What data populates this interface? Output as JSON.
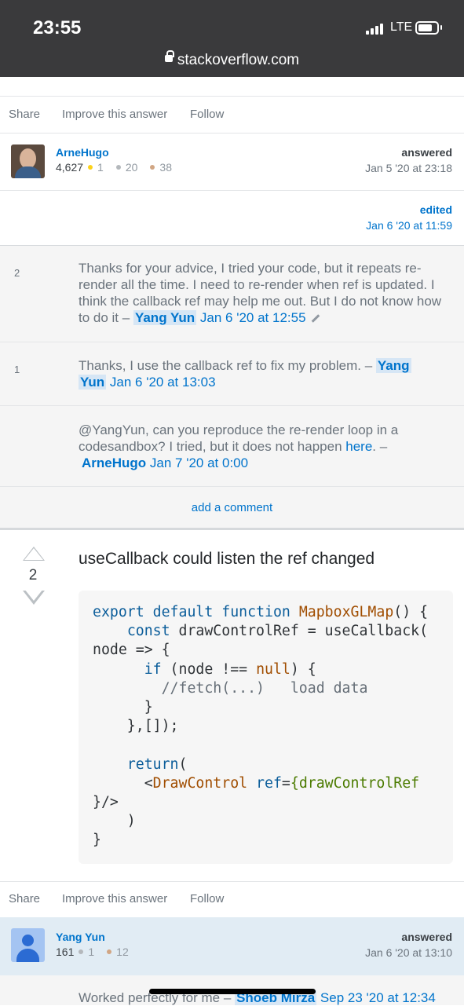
{
  "status_bar": {
    "time": "23:55",
    "network": "LTE",
    "url": "stackoverflow.com"
  },
  "post_actions_1": {
    "share": "Share",
    "improve": "Improve this answer",
    "follow": "Follow"
  },
  "answer_user_1": {
    "name": "ArneHugo",
    "reputation": "4,627",
    "gold": "1",
    "silver": "20",
    "bronze": "38",
    "action": "answered",
    "date": "Jan 5 '20 at 23:18"
  },
  "editor_1": {
    "action": "edited",
    "date": "Jan 6 '20 at 11:59"
  },
  "comments": [
    {
      "score": "2",
      "text": "Thanks for your advice, I tried your code, but it repeats re-render all the time. I need to re-render when ref is updated. I think the callback ref may help me out. But I do not know how to do it –",
      "user": "Yang Yun",
      "date": "Jan 6 '20 at 12:55"
    },
    {
      "score": "1",
      "text": "Thanks, I use the callback ref to fix my problem. –",
      "user_a": "Yang",
      "user_b": "Yun",
      "date": "Jan 6 '20 at 13:03"
    },
    {
      "score": "",
      "text_a": "@YangYun, can you reproduce the re-render loop in a codesandbox? I tried, but it does not happen",
      "link": "here",
      "text_b": ". –",
      "user": "ArneHugo",
      "date": "Jan 7 '20 at 0:00"
    }
  ],
  "add_comment": "add a comment",
  "answer_2": {
    "votes": "2",
    "text": "useCallback could listen the ref changed"
  },
  "post_actions_2": {
    "share": "Share",
    "improve": "Improve this answer",
    "follow": "Follow"
  },
  "answer_user_2": {
    "name": "Yang Yun",
    "reputation": "161",
    "silver": "1",
    "bronze": "12",
    "action": "answered",
    "date": "Jan 6 '20 at 13:10"
  },
  "bottom_comment": {
    "text": "Worked perfectly for me –",
    "user": "Shoeb Mirza",
    "date": "Sep 23 '20 at 12:34"
  },
  "colors": {
    "link": "#0074cc",
    "status_bar": "#3a3a3c",
    "user_highlight": "#e1ecf4"
  }
}
